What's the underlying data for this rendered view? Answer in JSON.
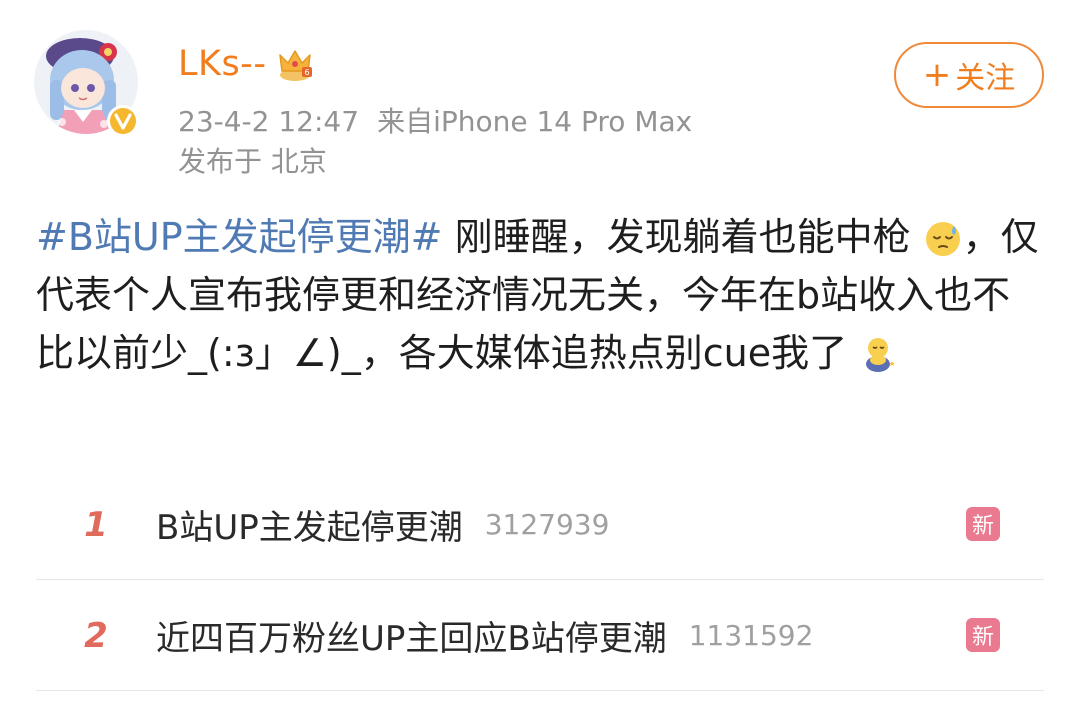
{
  "post": {
    "username": "LKs--",
    "timestamp": "23-4-2 12:47",
    "source": "来自iPhone 14 Pro Max",
    "location": "发布于 北京",
    "follow_label": "关注",
    "follow_icon": "+",
    "hashtag": "#B站UP主发起停更潮#",
    "text_part1": " 刚睡醒，发现躺着也能中枪",
    "text_part2": "，仅代表个人宣布我停更和经济情况无关，今年在b站收入也不比以前少_(:з」∠)_，各大媒体追热点别cue我了 ",
    "emoji_1": "sleepy-sweat-face-emoji",
    "emoji_2": "sitting-hugging-emoji",
    "avatar_icon": "anime-girl-avatar",
    "verified_icon": "verified-v-badge",
    "crown_icon": "gold-crown-badge"
  },
  "colors": {
    "username": "#f07e1e",
    "hashtag": "#4f7ab3",
    "rank": "#e06a5c",
    "new_badge": "#ea7a8f"
  },
  "trending": [
    {
      "rank": "1",
      "title": "B站UP主发起停更潮",
      "count": "3127939",
      "badge": "新"
    },
    {
      "rank": "2",
      "title": "近四百万粉丝UP主回应B站停更潮",
      "count": "1131592",
      "badge": "新"
    }
  ]
}
